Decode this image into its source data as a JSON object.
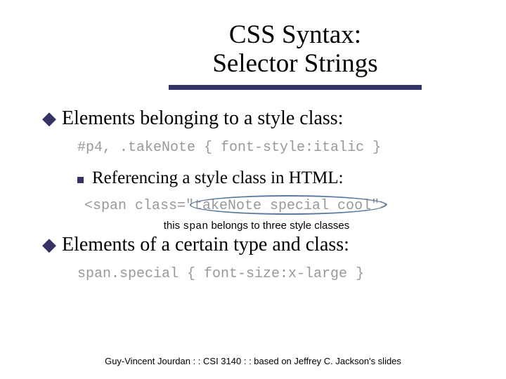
{
  "title": {
    "line1": "CSS Syntax:",
    "line2": "Selector Strings"
  },
  "bullets": {
    "b1": "Elements belonging to a style class:",
    "code1": "#p4, .takeNote { font-style:italic }",
    "b2": "Referencing a style class in HTML:",
    "html_example": "<span class=\"takeNote special cool\">",
    "caption_pre": "this ",
    "caption_mono": "span",
    "caption_post": " belongs to three style classes",
    "b3": "Elements of a certain type and class:",
    "code2": "span.special { font-size:x-large }"
  },
  "footer": "Guy-Vincent Jourdan : : CSI 3140 : : based on Jeffrey C. Jackson's slides"
}
